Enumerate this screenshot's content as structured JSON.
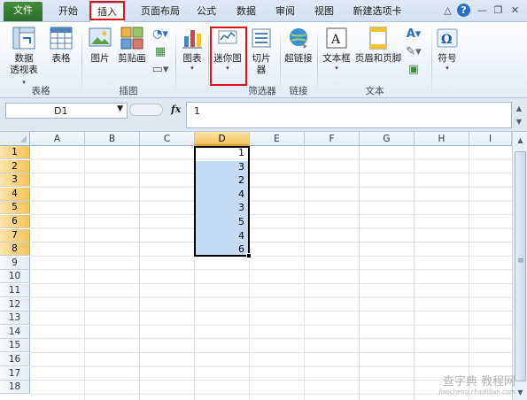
{
  "tabs": [
    "文件",
    "开始",
    "插入",
    "页面布局",
    "公式",
    "数据",
    "审阅",
    "视图",
    "新建选项卡"
  ],
  "window_controls": [
    "help-icon",
    "minimize-icon",
    "restore-icon",
    "close-icon"
  ],
  "ribbon": {
    "pivot_line1": "数据",
    "pivot_line2": "透视表",
    "table": "表格",
    "picture": "图片",
    "clipart": "剪贴画",
    "chart": "图表",
    "sparkline": "迷你图",
    "slicer": "切片器",
    "hyperlink": "超链接",
    "textbox": "文本框",
    "header_footer": "页眉和页脚",
    "symbol": "符号",
    "groups": {
      "tables": "表格",
      "illustrations": "插图",
      "filter": "筛选器",
      "links": "链接",
      "text": "文本"
    }
  },
  "formula_bar": {
    "name_box": "D1",
    "fx": "fx",
    "value": "1"
  },
  "sheet": {
    "columns": [
      "A",
      "B",
      "C",
      "D",
      "E",
      "F",
      "G",
      "H",
      "I"
    ],
    "selected_column": "D",
    "rows": [
      "1",
      "2",
      "3",
      "4",
      "5",
      "6",
      "7",
      "8",
      "9",
      "10",
      "11",
      "12",
      "13",
      "14",
      "15",
      "16",
      "17",
      "18"
    ],
    "d_values": [
      "1",
      "3",
      "2",
      "4",
      "3",
      "5",
      "4",
      "6"
    ]
  },
  "colors": {
    "file_tab": "#2d6f2a",
    "highlight": "#d8151b",
    "selection_fill": "#c5dbf3",
    "header_selected": "#f6c35d"
  },
  "watermark": {
    "main": "查字典 教程网",
    "sub": "jiaocheng.chazidian.com"
  }
}
